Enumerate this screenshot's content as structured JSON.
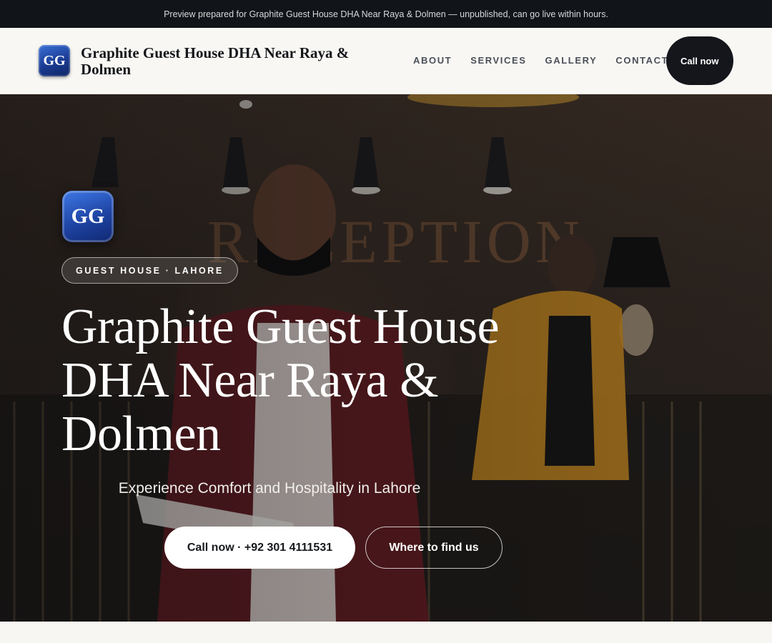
{
  "announcement": "Preview prepared for Graphite Guest House DHA Near Raya & Dolmen — unpublished, can go live within hours.",
  "header": {
    "logo_initials": "GG",
    "brand_name": "Graphite Guest House DHA Near Raya & Dolmen",
    "nav": [
      "ABOUT",
      "SERVICES",
      "GALLERY",
      "CONTACT"
    ],
    "call_label": "Call now"
  },
  "hero": {
    "logo_initials": "GG",
    "eyebrow": "GUEST HOUSE · LAHORE",
    "title": "Graphite Guest House DHA Near Raya & Dolmen",
    "subtitle": "Experience Comfort and Hospitality in Lahore",
    "primary_cta": "Call now · +92 301 4111531",
    "secondary_cta": "Where to find us"
  },
  "colors": {
    "topbar_bg": "#111418",
    "accent_blue": "#1e44a3",
    "dark_button": "#14161c"
  }
}
